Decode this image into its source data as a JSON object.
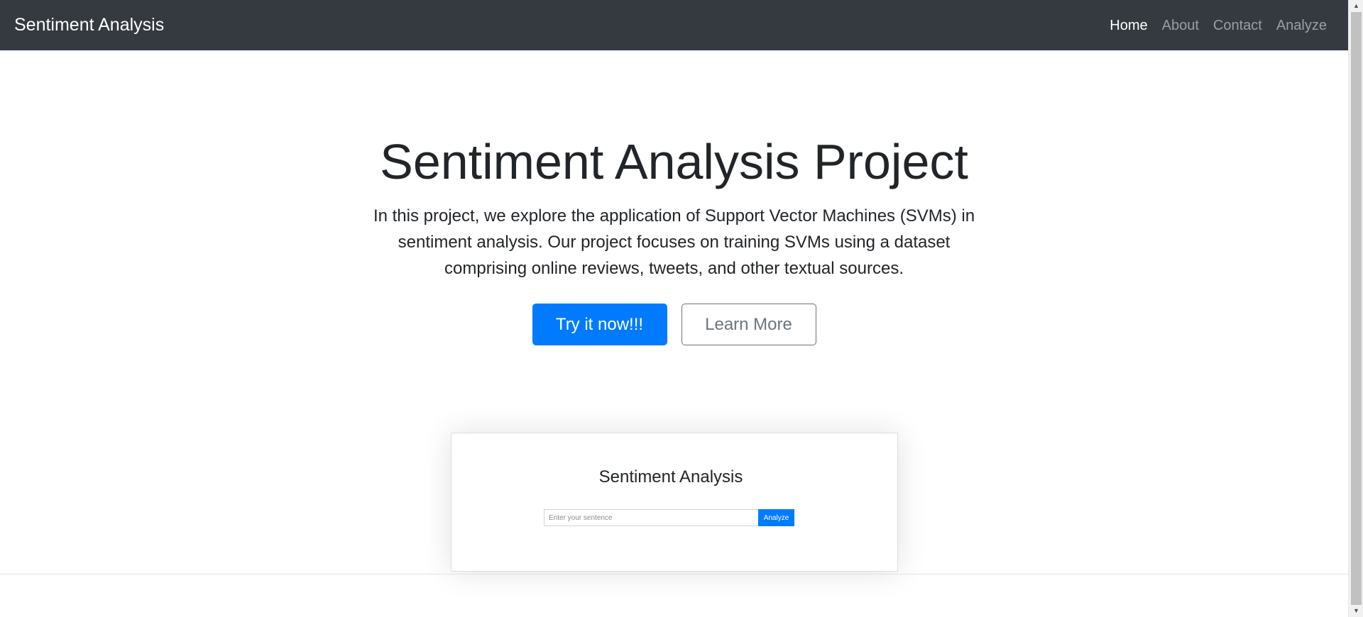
{
  "navbar": {
    "brand": "Sentiment Analysis",
    "links": [
      {
        "label": "Home",
        "active": true
      },
      {
        "label": "About",
        "active": false
      },
      {
        "label": "Contact",
        "active": false
      },
      {
        "label": "Analyze",
        "active": false
      }
    ]
  },
  "hero": {
    "title": "Sentiment Analysis Project",
    "lead": "In this project, we explore the application of Support Vector Machines (SVMs) in sentiment analysis. Our project focuses on training SVMs using a dataset comprising online reviews, tweets, and other textual sources.",
    "primary_button": "Try it now!!!",
    "secondary_button": "Learn More"
  },
  "demo": {
    "title": "Sentiment Analysis",
    "input_placeholder": "Enter your sentence",
    "input_value": "",
    "button_label": "Analyze"
  },
  "colors": {
    "navbar_bg": "#343a40",
    "primary": "#007bff",
    "secondary": "#6c757d"
  },
  "icons": {
    "scroll_up": "scroll-up-arrow-icon",
    "scroll_down": "scroll-down-arrow-icon"
  }
}
